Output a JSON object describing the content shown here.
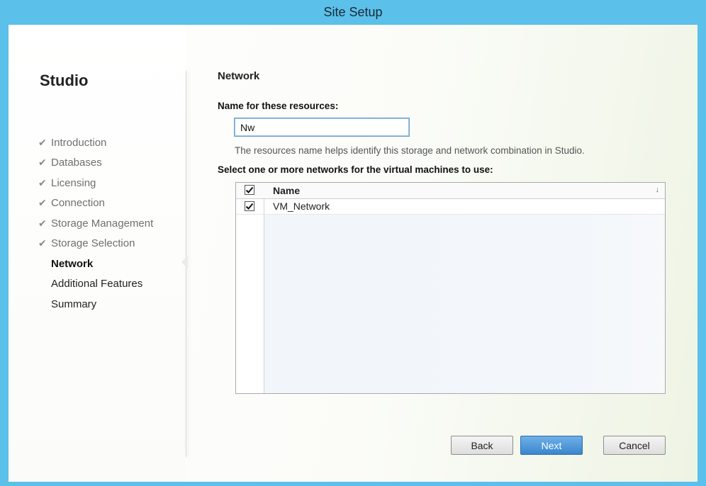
{
  "window": {
    "title": "Site Setup"
  },
  "sidebar": {
    "title": "Studio",
    "steps": [
      {
        "label": "Introduction",
        "state": "done"
      },
      {
        "label": "Databases",
        "state": "done"
      },
      {
        "label": "Licensing",
        "state": "done"
      },
      {
        "label": "Connection",
        "state": "done"
      },
      {
        "label": "Storage Management",
        "state": "done"
      },
      {
        "label": "Storage Selection",
        "state": "done"
      },
      {
        "label": "Network",
        "state": "current"
      },
      {
        "label": "Additional Features",
        "state": "pending"
      },
      {
        "label": "Summary",
        "state": "pending"
      }
    ]
  },
  "main": {
    "section_title": "Network",
    "name_label": "Name for these resources:",
    "name_value": "Nw",
    "help_text": "The resources name helps identify this storage and network combination in Studio.",
    "select_label": "Select one or more networks for the virtual machines to use:",
    "grid": {
      "header_name": "Name",
      "header_checked": true,
      "rows": [
        {
          "name": "VM_Network",
          "checked": true
        }
      ]
    }
  },
  "buttons": {
    "back": "Back",
    "next": "Next",
    "cancel": "Cancel"
  },
  "colors": {
    "titlebar": "#5bc0ea",
    "accent": "#3a86cf"
  }
}
